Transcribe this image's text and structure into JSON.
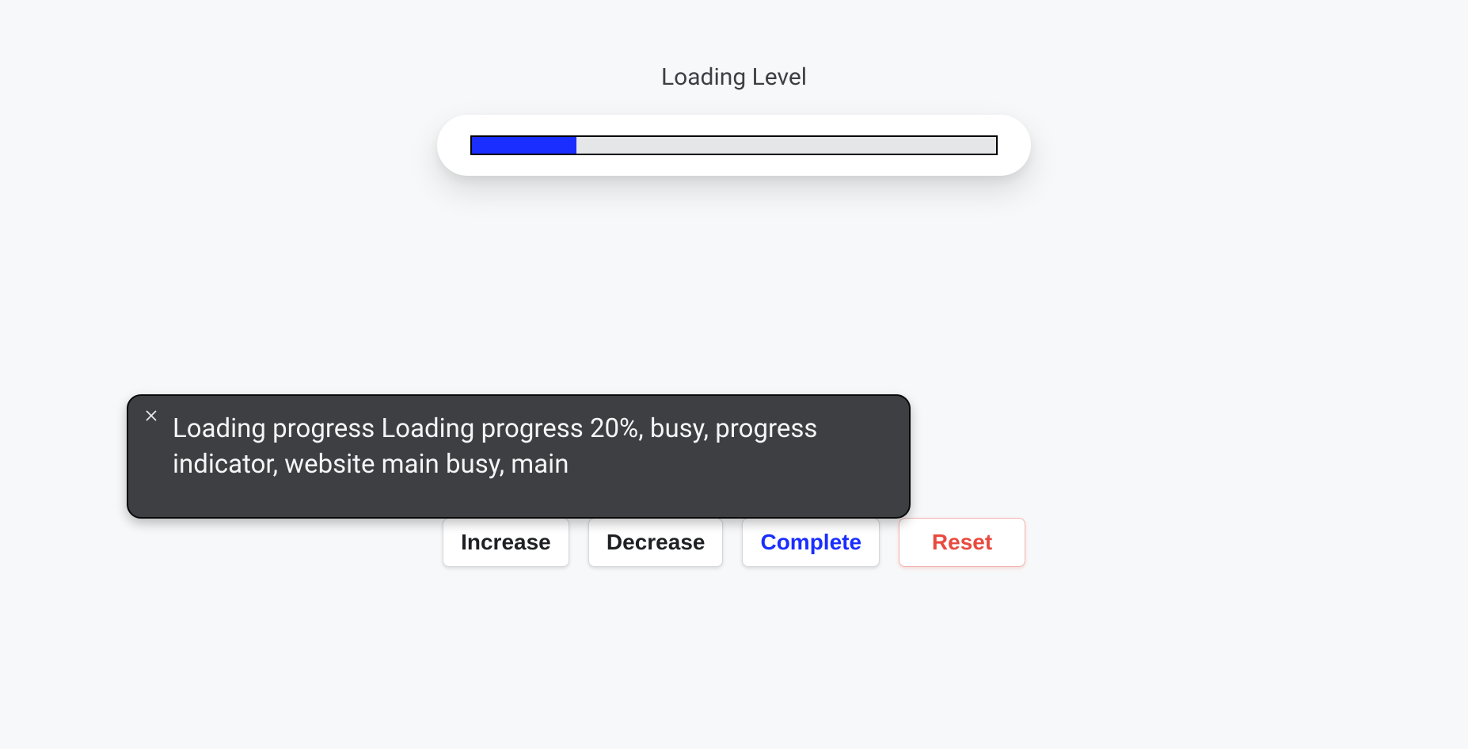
{
  "title": "Loading Level",
  "progress": {
    "percent": 20
  },
  "buttons": {
    "increase": "Increase",
    "decrease": "Decrease",
    "complete": "Complete",
    "reset": "Reset"
  },
  "tooltip": {
    "message": "Loading progress Loading progress 20%, busy, progress indicator, website main busy, main"
  }
}
